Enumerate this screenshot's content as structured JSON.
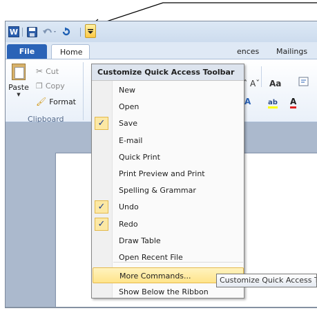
{
  "qat": {
    "app_icon_letter": "W",
    "icons": [
      "word-icon",
      "save-icon",
      "undo-icon",
      "redo-icon",
      "customize-dropdown-icon"
    ]
  },
  "tabs": {
    "file": "File",
    "home": "Home",
    "references_partial": "ences",
    "mailings": "Mailings"
  },
  "clipboard": {
    "paste": "Paste",
    "cut": "Cut",
    "copy": "Copy",
    "format": "Format",
    "group_label": "Clipboard"
  },
  "font_group": {
    "grow_shrink": "Aˆ Aˇ",
    "change_case": "Aa",
    "highlight_letters": "ab"
  },
  "menu": {
    "header": "Customize Quick Access Toolbar",
    "items": [
      {
        "label": "New",
        "checked": false
      },
      {
        "label": "Open",
        "checked": false
      },
      {
        "label": "Save",
        "checked": true
      },
      {
        "label": "E-mail",
        "checked": false
      },
      {
        "label": "Quick Print",
        "checked": false
      },
      {
        "label": "Print Preview and Print",
        "checked": false
      },
      {
        "label": "Spelling & Grammar",
        "checked": false
      },
      {
        "label": "Undo",
        "checked": true
      },
      {
        "label": "Redo",
        "checked": true
      },
      {
        "label": "Draw Table",
        "checked": false
      },
      {
        "label": "Open Recent File",
        "checked": false
      },
      {
        "label": "More Commands...",
        "checked": false,
        "highlighted": true
      },
      {
        "label": "Show Below the Ribbon",
        "checked": false
      }
    ],
    "check_glyph": "✓"
  },
  "tooltip": {
    "text": "Customize Quick Access Toolbar"
  },
  "colors": {
    "file_tab": "#2a63b7",
    "highlight": "#ffe48a",
    "check_bg": "#fce8a4"
  }
}
